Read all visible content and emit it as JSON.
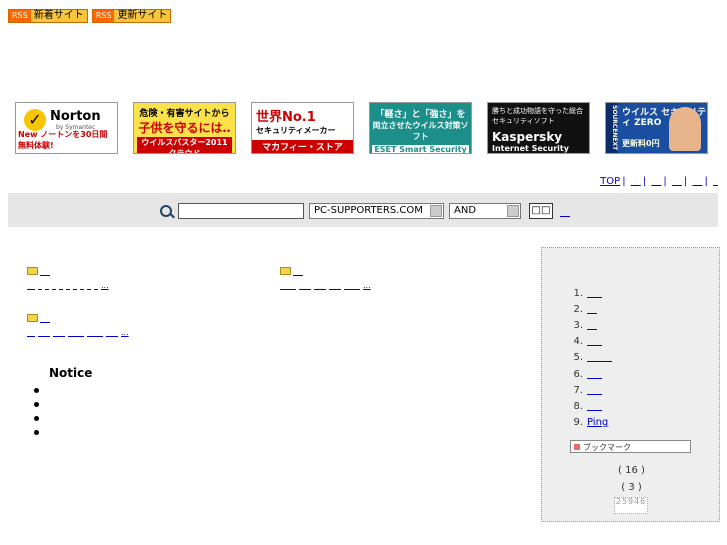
{
  "rss": {
    "tag": "RSS",
    "new_sites": "新着サイト",
    "updated_sites": "更新サイト"
  },
  "banners": {
    "norton": {
      "name": "Norton",
      "sub": "by Symantec",
      "foot": "New ノートンを30日間無料体験!"
    },
    "kids": {
      "line1": "危険・有害サイトから",
      "line2": "子供を守るには‥",
      "line3": "ウイルスバスター2011 クラウド"
    },
    "mcafee": {
      "line1": "世界No.1",
      "line2": "セキュリティメーカー",
      "line3": "マカフィー・ストア"
    },
    "eset": {
      "line1": "「軽さ」と「強さ」を",
      "line2": "両立させたウイルス対策ソフト",
      "line3": "ESET Smart Security 4"
    },
    "kaspersky": {
      "line1": "勝ちと成功物語を守った総合セキュリティソフト",
      "line2": "Kaspersky",
      "line3": "Internet Security 2011"
    },
    "sourcenext": {
      "side": "SOURCENEXT",
      "line1": "ウイルス セキュリティ ZERO",
      "line2": "更新料0円"
    }
  },
  "topnav": {
    "top": "TOP",
    "items": [
      "",
      "",
      "",
      "",
      ""
    ]
  },
  "search": {
    "value": "",
    "scope_selected": "PC-SUPPORTERS.COM",
    "mode_selected": "AND",
    "button": "",
    "advanced_link": ""
  },
  "categories": [
    {
      "subs": [
        "",
        "",
        "",
        "",
        "",
        "",
        "",
        "",
        "",
        ""
      ],
      "more": "..."
    },
    {
      "subs": [
        "",
        "",
        "",
        "",
        ""
      ],
      "more": "..."
    },
    {
      "subs": [
        "",
        "",
        "",
        "",
        "",
        "",
        ""
      ],
      "more": "..."
    }
  ],
  "notice": {
    "title": "Notice",
    "items": [
      "",
      "",
      "",
      ""
    ]
  },
  "ranking": {
    "items": [
      {
        "num": "1.",
        "label": ""
      },
      {
        "num": "2.",
        "label": ""
      },
      {
        "num": "3.",
        "label": ""
      },
      {
        "num": "4.",
        "label": ""
      },
      {
        "num": "5.",
        "label": ""
      },
      {
        "num": "6.",
        "label": ""
      },
      {
        "num": "7.",
        "label": ""
      },
      {
        "num": "8.",
        "label": ""
      },
      {
        "num": "9.",
        "label": "Ping"
      }
    ],
    "bookmark_label": "ブックマーク",
    "count_a": "( 16 )",
    "count_b": "( 3 )",
    "counter_digits": "25946"
  }
}
